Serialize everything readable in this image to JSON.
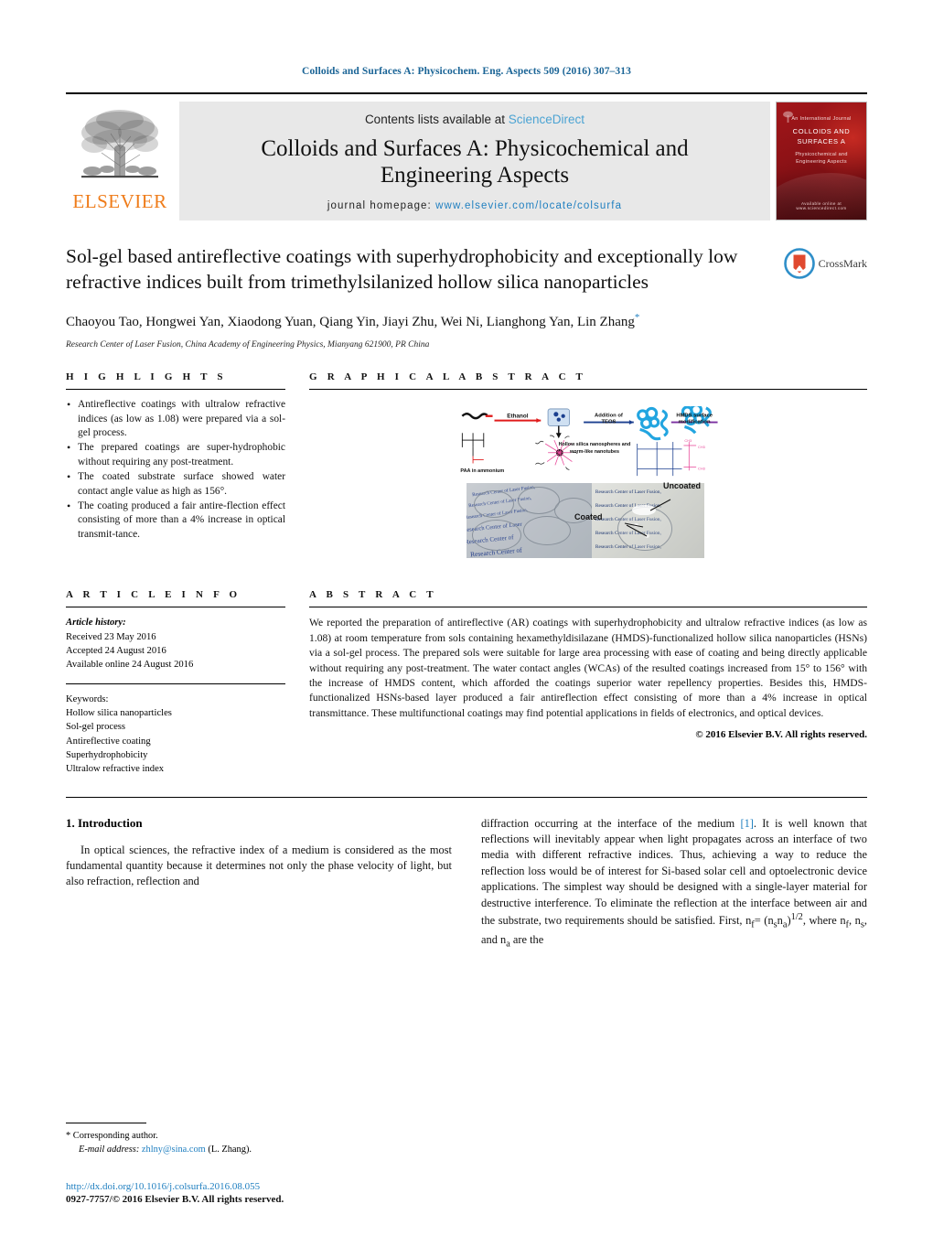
{
  "running_head": "Colloids and Surfaces A: Physicochem. Eng. Aspects 509 (2016) 307–313",
  "masthead": {
    "publisher": "ELSEVIER",
    "contents_prefix": "Contents lists available at ",
    "contents_link": "ScienceDirect",
    "journal_title_line1": "Colloids and Surfaces A: Physicochemical and",
    "journal_title_line2": "Engineering Aspects",
    "homepage_label": "journal homepage:",
    "homepage_url": "www.elsevier.com/locate/colsurfa",
    "cover": {
      "top_small": "An International Journal",
      "name": "COLLOIDS AND SURFACES A",
      "subtitle_line1": "Physicochemical and",
      "subtitle_line2": "Engineering Aspects",
      "bottom": "Available online at www.sciencedirect.com"
    }
  },
  "article": {
    "title": "Sol-gel based antireflective coatings with superhydrophobicity and exceptionally low refractive indices built from trimethylsilanized hollow silica nanoparticles",
    "authors": "Chaoyou Tao, Hongwei Yan, Xiaodong Yuan, Qiang Yin, Jiayi Zhu, Wei Ni, Lianghong Yan, Lin Zhang",
    "corresponding_marker": "*",
    "affiliation": "Research Center of Laser Fusion, China Academy of Engineering Physics, Mianyang 621900, PR China",
    "crossmark_label": "CrossMark"
  },
  "highlights": {
    "heading": "H I G H L I G H T S",
    "items": [
      "Antireflective coatings with ultralow refractive indices (as low as 1.08) were prepared via a sol-gel process.",
      "The prepared coatings are super-hydrophobic without requiring any post-treatment.",
      "The coated substrate surface showed water contact angle value as high as 156°.",
      "The coating produced a fair antire-flection effect consisting of more than a 4% increase in optical transmit-tance."
    ]
  },
  "graphical_abstract": {
    "heading": "G R A P H I C A L   A B S T R A C T",
    "labels": {
      "ethanol": "Ethanol",
      "teos": "Addition of TEOS",
      "hmds": "HMDS surface modification",
      "paa": "PAA in ammonium",
      "caption": "Hollow silica nanospheres and worm-like nanotubes",
      "uncoated": "Uncoated",
      "coated": "Coated",
      "photo_text_left": "Research Center of Laser Fusion",
      "photo_text_right": "Research Center of Laser Fusion,"
    }
  },
  "article_info": {
    "heading": "A R T I C L E   I N F O",
    "history_label": "Article history:",
    "history": [
      "Received 23 May 2016",
      "Accepted 24 August 2016",
      "Available online 24 August 2016"
    ],
    "keywords_label": "Keywords:",
    "keywords": [
      "Hollow silica nanoparticles",
      "Sol-gel process",
      "Antireflective coating",
      "Superhydrophobicity",
      "Ultralow refractive index"
    ]
  },
  "abstract": {
    "heading": "A B S T R A C T",
    "text": "We reported the preparation of antireflective (AR) coatings with superhydrophobicity and ultralow refractive indices (as low as 1.08) at room temperature from sols containing hexamethyldisilazane (HMDS)-functionalized hollow silica nanoparticles (HSNs) via a sol-gel process. The prepared sols were suitable for large area processing with ease of coating and being directly applicable without requiring any post-treatment. The water contact angles (WCAs) of the resulted coatings increased from 15° to 156° with the increase of HMDS content, which afforded the coatings superior water repellency properties. Besides this, HMDS-functionalized HSNs-based layer produced a fair antireflection effect consisting of more than a 4% increase in optical transmittance. These multifunctional coatings may find potential applications in fields of electronics, and optical devices.",
    "copyright": "© 2016 Elsevier B.V. All rights reserved."
  },
  "introduction": {
    "heading": "1.  Introduction",
    "col_left": "In optical sciences, the refractive index of a medium is considered as the most fundamental quantity because it determines not only the phase velocity of light, but also refraction, reflection and",
    "col_right_pre": "diffraction occurring at the interface of the medium ",
    "col_right_ref": "[1]",
    "col_right_post": ". It is well known that reflections will inevitably appear when light propagates across an interface of two media with different refractive indices. Thus, achieving a way to reduce the reflection loss would be of interest for Si-based solar cell and optoelectronic device applications. The simplest way should be designed with a single-layer material for destructive interference. To eliminate the reflection at the interface between air and the substrate, two requirements should be satisfied. First, n",
    "formula_sub1": "f",
    "formula_eq": "= (n",
    "formula_sub2": "s",
    "formula_n": "n",
    "formula_sub3": "a",
    "formula_close": ")",
    "formula_exp": "1/2",
    "formula_tail": ", where n",
    "formula_sub4": "f",
    "formula_c1": ", n",
    "formula_sub5": "s",
    "formula_c2": ", and n",
    "formula_sub6": "a",
    "formula_end": " are the"
  },
  "footer": {
    "corresponding": "*  Corresponding author.",
    "email_label": "E-mail address:",
    "email": "zhlny@sina.com",
    "email_suffix": "(L. Zhang).",
    "doi": "http://dx.doi.org/10.1016/j.colsurfa.2016.08.055",
    "issn": "0927-7757/© 2016 Elsevier B.V. All rights reserved."
  },
  "colors": {
    "link": "#1f7fc0",
    "running_head": "#1a6496",
    "elsevier_orange": "#ef7c1a",
    "band_gray": "#e8e8e8"
  }
}
